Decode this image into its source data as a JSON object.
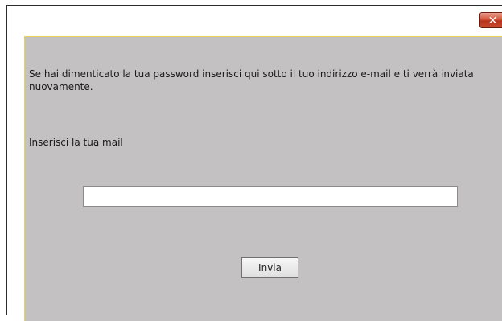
{
  "dialog": {
    "close_label": "✕",
    "instructions": "Se hai dimenticato la tua password inserisci qui sotto il tuo indirizzo e-mail e ti verrà inviata nuovamente.",
    "mail_label": "Inserisci la tua mail",
    "email_value": "",
    "submit_label": "Invia"
  },
  "colors": {
    "panel_bg": "#c3c1c1",
    "panel_border": "#e3d35a",
    "close_button": "#c84a30"
  }
}
